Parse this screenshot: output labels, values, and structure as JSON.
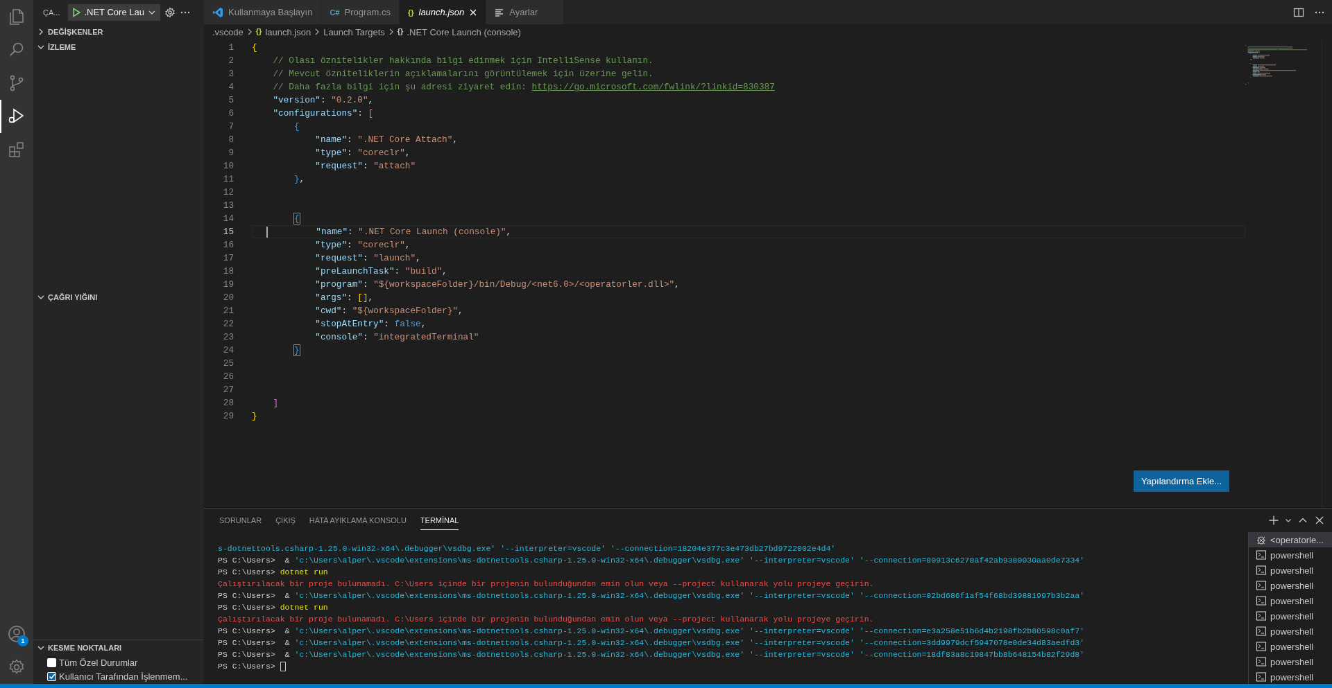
{
  "activity_bar": {
    "items": [
      {
        "kind": "explorer",
        "selected": false
      },
      {
        "kind": "search",
        "selected": false
      },
      {
        "kind": "source-control",
        "selected": false
      },
      {
        "kind": "run-debug",
        "selected": true
      },
      {
        "kind": "extensions",
        "selected": false
      }
    ],
    "account": {
      "badge": "1"
    }
  },
  "sidebar": {
    "title": "ÇA...",
    "launch_config": ".NET Core Lau",
    "sections": [
      {
        "title": "DEĞİŞKENLER",
        "expanded": false
      },
      {
        "title": "İZLEME",
        "expanded": true
      },
      {
        "title": "ÇAĞRI YIĞINI",
        "expanded": true
      },
      {
        "title": "KESME NOKTALARI",
        "expanded": true
      }
    ],
    "breakpoints": [
      {
        "label": "Tüm Özel Durumlar",
        "checked": false
      },
      {
        "label": "Kullanıcı Tarafından İşlenmem...",
        "checked": true
      }
    ]
  },
  "tabs": [
    {
      "kind": "welcome",
      "label": "Kullanmaya Başlayın",
      "selected": false,
      "preview": false
    },
    {
      "kind": "csharp",
      "icon": "C#",
      "label": "Program.cs",
      "selected": false,
      "preview": false
    },
    {
      "kind": "json",
      "icon": "{}",
      "label": "launch.json",
      "selected": true,
      "preview": true
    },
    {
      "kind": "settings",
      "label": "Ayarlar",
      "selected": false,
      "preview": false
    }
  ],
  "breadcrumb": [
    {
      "kind": "folder",
      "text": ".vscode"
    },
    {
      "kind": "file",
      "icon": "{}",
      "text": "launch.json"
    },
    {
      "kind": "plain",
      "text": "Launch Targets"
    },
    {
      "kind": "symbol",
      "icon": "{}",
      "text": ".NET Core Launch (console)"
    }
  ],
  "editor": {
    "lines": [
      {
        "number": "1",
        "current": false,
        "tokens": [
          {
            "kind": "b1",
            "text": "{"
          }
        ]
      },
      {
        "number": "2",
        "current": false,
        "tokens": [
          {
            "kind": "c",
            "text": "    // Olası öznitelikler hakkında bilgi edinmek için IntelliSense kullanın."
          }
        ]
      },
      {
        "number": "3",
        "current": false,
        "tokens": [
          {
            "kind": "c",
            "text": "    // Mevcut özniteliklerin açıklamalarını görüntülemek için üzerine gelin."
          }
        ]
      },
      {
        "number": "4",
        "current": false,
        "tokens": [
          {
            "kind": "c",
            "text": "    // Daha fazla bilgi için şu adresi ziyaret edin: "
          },
          {
            "kind": "u",
            "text": "https://go.microsoft.com/fwlink/?linkid=830387"
          }
        ]
      },
      {
        "number": "5",
        "current": false,
        "tokens": [
          {
            "kind": "k",
            "text": "    \"version\""
          },
          {
            "kind": "p",
            "text": ": "
          },
          {
            "kind": "s",
            "text": "\"0.2.0\""
          },
          {
            "kind": "p",
            "text": ","
          }
        ]
      },
      {
        "number": "6",
        "current": false,
        "tokens": [
          {
            "kind": "k",
            "text": "    \"configurations\""
          },
          {
            "kind": "p",
            "text": ": "
          },
          {
            "kind": "b2",
            "text": "["
          }
        ]
      },
      {
        "number": "7",
        "current": false,
        "tokens": [
          {
            "kind": "b3",
            "text": "        {"
          }
        ]
      },
      {
        "number": "8",
        "current": false,
        "tokens": [
          {
            "kind": "k",
            "text": "            \"name\""
          },
          {
            "kind": "p",
            "text": ": "
          },
          {
            "kind": "s",
            "text": "\".NET Core Attach\""
          },
          {
            "kind": "p",
            "text": ","
          }
        ]
      },
      {
        "number": "9",
        "current": false,
        "tokens": [
          {
            "kind": "k",
            "text": "            \"type\""
          },
          {
            "kind": "p",
            "text": ": "
          },
          {
            "kind": "s",
            "text": "\"coreclr\""
          },
          {
            "kind": "p",
            "text": ","
          }
        ]
      },
      {
        "number": "10",
        "current": false,
        "tokens": [
          {
            "kind": "k",
            "text": "            \"request\""
          },
          {
            "kind": "p",
            "text": ": "
          },
          {
            "kind": "s",
            "text": "\"attach\""
          }
        ]
      },
      {
        "number": "11",
        "current": false,
        "tokens": [
          {
            "kind": "b3",
            "text": "        }"
          },
          {
            "kind": "p",
            "text": ","
          }
        ]
      },
      {
        "number": "12",
        "current": false
      },
      {
        "number": "13",
        "current": false
      },
      {
        "number": "14",
        "current": false,
        "tokens": [
          {
            "kind": "b3m",
            "text": "        {"
          }
        ]
      },
      {
        "number": "15",
        "current": true,
        "tokens": [
          {
            "kind": "k",
            "text": "            \"name\""
          },
          {
            "kind": "p",
            "text": ": "
          },
          {
            "kind": "s",
            "text": "\".NET Core Launch (console)\""
          },
          {
            "kind": "p",
            "text": ","
          }
        ]
      },
      {
        "number": "16",
        "current": false,
        "tokens": [
          {
            "kind": "k",
            "text": "            \"type\""
          },
          {
            "kind": "p",
            "text": ": "
          },
          {
            "kind": "s",
            "text": "\"coreclr\""
          },
          {
            "kind": "p",
            "text": ","
          }
        ]
      },
      {
        "number": "17",
        "current": false,
        "tokens": [
          {
            "kind": "k",
            "text": "            \"request\""
          },
          {
            "kind": "p",
            "text": ": "
          },
          {
            "kind": "s",
            "text": "\"launch\""
          },
          {
            "kind": "p",
            "text": ","
          }
        ]
      },
      {
        "number": "18",
        "current": false,
        "tokens": [
          {
            "kind": "k",
            "text": "            \"preLaunchTask\""
          },
          {
            "kind": "p",
            "text": ": "
          },
          {
            "kind": "s",
            "text": "\"build\""
          },
          {
            "kind": "p",
            "text": ","
          }
        ]
      },
      {
        "number": "19",
        "current": false,
        "tokens": [
          {
            "kind": "k",
            "text": "            \"program\""
          },
          {
            "kind": "p",
            "text": ": "
          },
          {
            "kind": "s",
            "text": "\"${workspaceFolder}/bin/Debug/<net6.0>/<operatorler.dll>\""
          },
          {
            "kind": "p",
            "text": ","
          }
        ]
      },
      {
        "number": "20",
        "current": false,
        "tokens": [
          {
            "kind": "k",
            "text": "            \"args\""
          },
          {
            "kind": "p",
            "text": ": "
          },
          {
            "kind": "b1",
            "text": "[]"
          },
          {
            "kind": "p",
            "text": ","
          }
        ]
      },
      {
        "number": "21",
        "current": false,
        "tokens": [
          {
            "kind": "k",
            "text": "            \"cwd\""
          },
          {
            "kind": "p",
            "text": ": "
          },
          {
            "kind": "s",
            "text": "\"${workspaceFolder}\""
          },
          {
            "kind": "p",
            "text": ","
          }
        ]
      },
      {
        "number": "22",
        "current": false,
        "tokens": [
          {
            "kind": "k",
            "text": "            \"stopAtEntry\""
          },
          {
            "kind": "p",
            "text": ": "
          },
          {
            "kind": "kw",
            "text": "false"
          },
          {
            "kind": "p",
            "text": ","
          }
        ]
      },
      {
        "number": "23",
        "current": false,
        "tokens": [
          {
            "kind": "k",
            "text": "            \"console\""
          },
          {
            "kind": "p",
            "text": ": "
          },
          {
            "kind": "s",
            "text": "\"integratedTerminal\""
          }
        ]
      },
      {
        "number": "24",
        "current": false,
        "tokens": [
          {
            "kind": "b3m",
            "text": "        }"
          }
        ]
      },
      {
        "number": "25",
        "current": false
      },
      {
        "number": "26",
        "current": false
      },
      {
        "number": "27",
        "current": false
      },
      {
        "number": "28",
        "current": false,
        "tokens": [
          {
            "kind": "b2",
            "text": "    ]"
          }
        ]
      },
      {
        "number": "29",
        "current": false,
        "tokens": [
          {
            "kind": "b1",
            "text": "}"
          }
        ]
      }
    ],
    "add_configuration_button": "Yapılandırma Ekle..."
  },
  "panel": {
    "tabs": [
      {
        "label": "SORUNLAR",
        "selected": false
      },
      {
        "label": "ÇIKIŞ",
        "selected": false
      },
      {
        "label": "HATA AYIKLAMA KONSOLU",
        "selected": false
      },
      {
        "label": "TERMİNAL",
        "selected": true
      }
    ],
    "terminal_lines": [
      {
        "kind": "output",
        "tokens": [
          {
            "kind": "str",
            "text": "s-dotnettools.csharp-1.25.0-win32-x64\\.debugger\\vsdbg.exe' '--interpreter=vscode' '--connection=18204e377c3e473db27bd9722002e4d4'"
          }
        ]
      },
      {
        "kind": "output",
        "tokens": [
          {
            "kind": "plain",
            "text": "PS C:\\Users>  & "
          },
          {
            "kind": "str",
            "text": "'c:\\Users\\alper\\.vscode\\extensions\\ms-dotnettools.csharp-1.25.0-win32-x64\\.debugger\\vsdbg.exe' '--interpreter=vscode' '--connection=80913c6278af42ab9380030aa0de7334'"
          }
        ]
      },
      {
        "kind": "output",
        "tokens": [
          {
            "kind": "plain",
            "text": "PS C:\\Users> "
          },
          {
            "kind": "cmd",
            "text": "dotnet run"
          }
        ]
      },
      {
        "kind": "output",
        "tokens": [
          {
            "kind": "err",
            "text": "Çalıştırılacak bir proje bulunamadı. C:\\Users içinde bir projenin bulunduğundan emin olun veya --project kullanarak yolu projeye geçirin."
          }
        ]
      },
      {
        "kind": "output",
        "tokens": [
          {
            "kind": "plain",
            "text": "PS C:\\Users>  & "
          },
          {
            "kind": "str",
            "text": "'c:\\Users\\alper\\.vscode\\extensions\\ms-dotnettools.csharp-1.25.0-win32-x64\\.debugger\\vsdbg.exe' '--interpreter=vscode' '--connection=02bd686f1af54f68bd39881997b3b2aa'"
          }
        ]
      },
      {
        "kind": "output",
        "tokens": [
          {
            "kind": "plain",
            "text": "PS C:\\Users> "
          },
          {
            "kind": "cmd",
            "text": "dotnet run"
          }
        ]
      },
      {
        "kind": "output",
        "tokens": [
          {
            "kind": "err",
            "text": "Çalıştırılacak bir proje bulunamadı. C:\\Users içinde bir projenin bulunduğundan emin olun veya --project kullanarak yolu projeye geçirin."
          }
        ]
      },
      {
        "kind": "output",
        "tokens": [
          {
            "kind": "plain",
            "text": "PS C:\\Users>  & "
          },
          {
            "kind": "str",
            "text": "'c:\\Users\\alper\\.vscode\\extensions\\ms-dotnettools.csharp-1.25.0-win32-x64\\.debugger\\vsdbg.exe' '--interpreter=vscode' '--connection=e3a258e51b6d4b2198fb2b80598c0af7'"
          }
        ]
      },
      {
        "kind": "output",
        "tokens": [
          {
            "kind": "plain",
            "text": "PS C:\\Users>  & "
          },
          {
            "kind": "str",
            "text": "'c:\\Users\\alper\\.vscode\\extensions\\ms-dotnettools.csharp-1.25.0-win32-x64\\.debugger\\vsdbg.exe' '--interpreter=vscode' '--connection=3dd9979dcf5947078e0de34d83aedfd3'"
          }
        ]
      },
      {
        "kind": "output",
        "tokens": [
          {
            "kind": "plain",
            "text": "PS C:\\Users>  & "
          },
          {
            "kind": "str",
            "text": "'c:\\Users\\alper\\.vscode\\extensions\\ms-dotnettools.csharp-1.25.0-win32-x64\\.debugger\\vsdbg.exe' '--interpreter=vscode' '--connection=18df83a8c19847bb8b648154b82f29d8'"
          }
        ]
      },
      {
        "kind": "input",
        "tokens": [
          {
            "kind": "plain",
            "text": "PS C:\\Users> "
          }
        ]
      }
    ],
    "terminals": [
      {
        "kind": "debug",
        "label": "<operatorle...",
        "selected": true
      },
      {
        "kind": "shell",
        "label": "powershell",
        "selected": false
      },
      {
        "kind": "shell",
        "label": "powershell",
        "selected": false
      },
      {
        "kind": "shell",
        "label": "powershell",
        "selected": false
      },
      {
        "kind": "shell",
        "label": "powershell",
        "selected": false
      },
      {
        "kind": "shell",
        "label": "powershell",
        "selected": false
      },
      {
        "kind": "shell",
        "label": "powershell",
        "selected": false
      },
      {
        "kind": "shell",
        "label": "powershell",
        "selected": false
      },
      {
        "kind": "shell",
        "label": "powershell",
        "selected": false
      },
      {
        "kind": "shell",
        "label": "powershell",
        "selected": false
      }
    ]
  }
}
